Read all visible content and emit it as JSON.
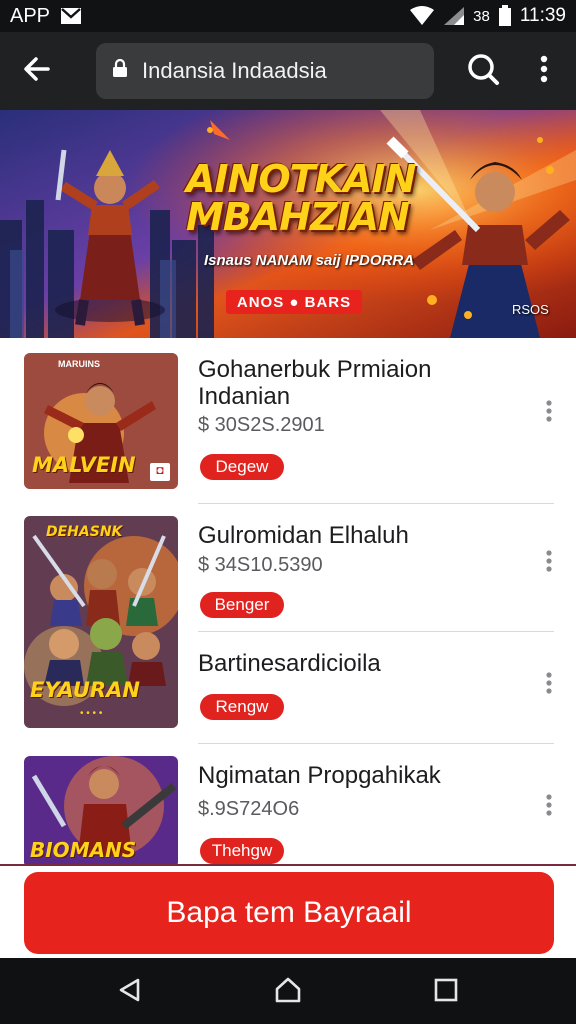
{
  "status_bar": {
    "app_label": "APP",
    "carrier": "38",
    "time": "11:39"
  },
  "toolbar": {
    "url_text": "Indansia Indaadsia"
  },
  "banner": {
    "title_line1": "AINOTKAIN",
    "title_line2": "MBAHZIAN",
    "subtitle": "Isnaus NANAM saij IPDORRA",
    "cta_label": "ANOS ● BARS",
    "tag": "RSOS"
  },
  "items": [
    {
      "title": "Gohanerbuk Prmiaion Indanian",
      "price": "$ 30S2S.2901",
      "button_label": "Degew",
      "thumb_caption": "MALVEIN",
      "thumb_top_text": "MARUINS",
      "thumb_badge": "◘"
    },
    {
      "title": "Gulromidan Elhaluh",
      "price": "$ 34S10.5390",
      "button_label": "Benger",
      "thumb_caption": "EYAURAN",
      "thumb_top_text": "DEHASNK",
      "thumb_badge": "• • • •"
    },
    {
      "title": "Bartinesardicioila",
      "price": "",
      "button_label": "Rengw",
      "thumb_caption": "",
      "thumb_top_text": "",
      "thumb_badge": ""
    },
    {
      "title": "Ngimatan Propgahikak",
      "price": "$.9S724O6",
      "button_label": "Thehgw",
      "thumb_caption": "BIOMANS",
      "thumb_top_text": "",
      "thumb_badge": ""
    }
  ],
  "bottom_cta": {
    "label": "Bapa tem Bayraail"
  },
  "icons": {
    "back": "arrow-left-icon",
    "lock": "lock-icon",
    "search": "search-icon",
    "menu": "more-vertical-icon",
    "mail": "mail-icon",
    "wifi": "wifi-icon",
    "signal": "signal-icon",
    "battery": "battery-icon",
    "nav_back": "triangle-back-icon",
    "nav_home": "home-icon",
    "nav_recents": "square-recents-icon"
  },
  "colors": {
    "accent_red": "#e0231f",
    "toolbar_bg": "#202123",
    "status_bg": "#111214"
  }
}
